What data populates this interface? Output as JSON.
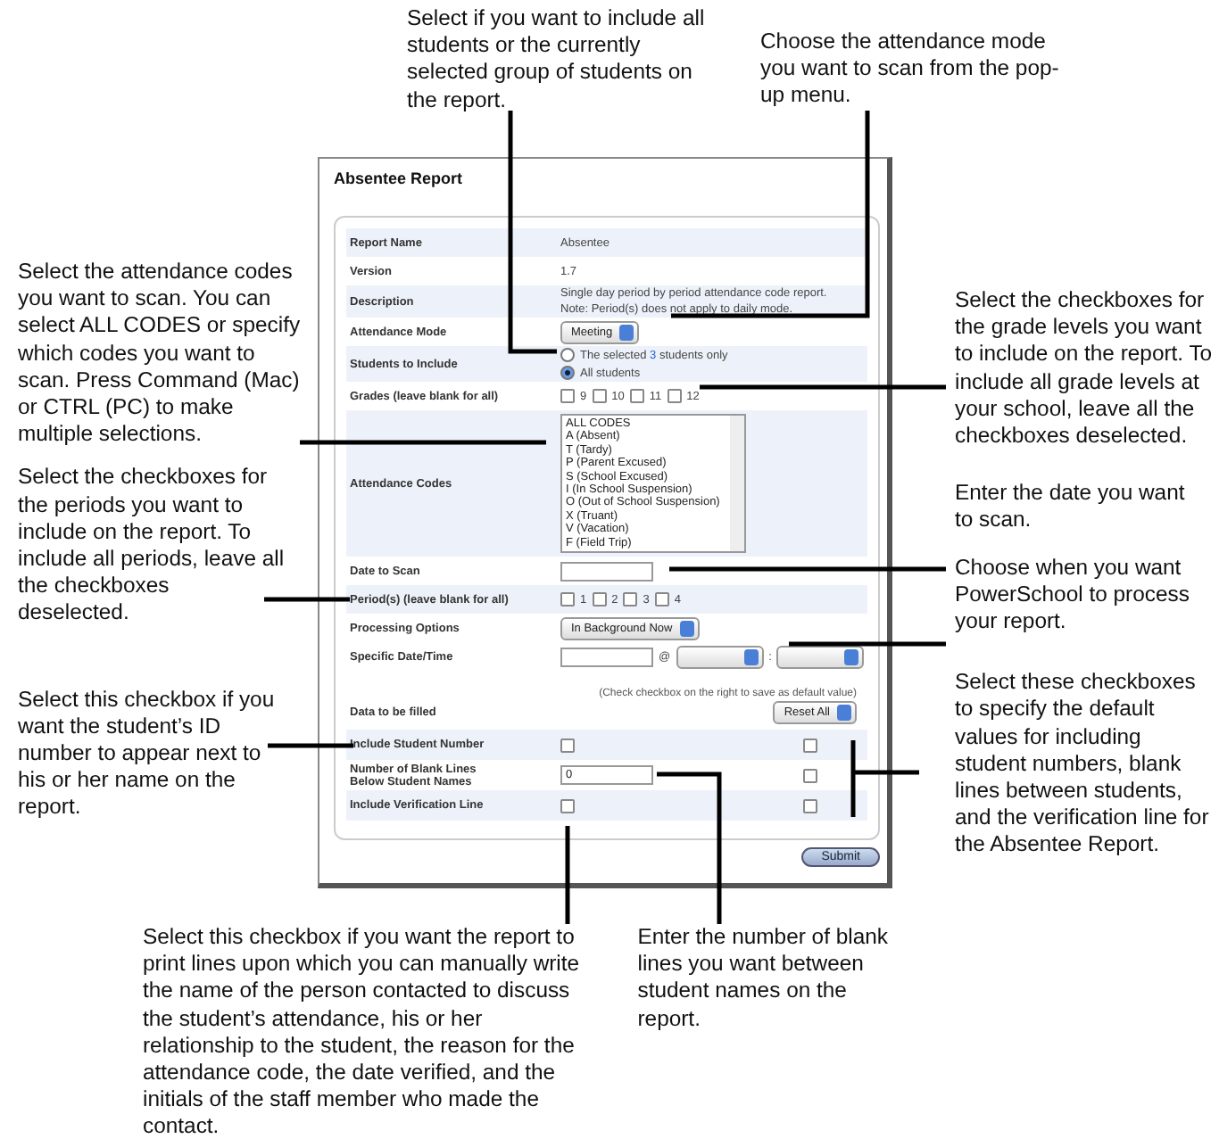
{
  "callouts": {
    "top": [
      "Select if you want to include all students or the currently selected group of students on the report.",
      "Choose the attendance mode you want to scan from the pop-up menu."
    ],
    "left": [
      "Select the attendance codes you want to scan. You can select ALL CODES or specify which codes you want to scan. Press Command (Mac) or CTRL (PC) to make multiple selections.",
      "Select the checkboxes for the periods you want to include on the report. To include all periods, leave all the checkboxes deselected.",
      "Select this checkbox if you want the student’s ID number to appear next to his or her name on the report."
    ],
    "right": [
      "Select the checkboxes for the  grade levels you want to include on the report. To include all grade levels at your school, leave all the checkboxes deselected.",
      "Enter the date you want to scan.",
      "Choose when you want PowerSchool to process your report.",
      "Select these checkboxes to specify the default values for including student numbers, blank lines between students, and the verification line for the Absentee Report."
    ],
    "bottom": [
      "Select this checkbox if you want the report to print lines upon which you can manually write the name of the person contacted to discuss the student’s attendance, his or her relationship to the student, the reason for the attendance code, the date verified, and the initials of the staff member who made the contact.",
      "Enter the number of blank lines you want between student names on the report."
    ]
  },
  "window": {
    "title": "Absentee Report",
    "submit": "Submit"
  },
  "rows": [
    {
      "kind": "info",
      "label": "Report Name",
      "lines": [
        "Absentee"
      ]
    },
    {
      "kind": "info",
      "label": "Version",
      "lines": [
        "1.7"
      ]
    },
    {
      "kind": "info",
      "label": "Description",
      "lines": [
        "Single day period by period attendance code report.",
        "Note: Period(s) does not apply to daily mode."
      ]
    },
    {
      "kind": "select",
      "label": "Attendance Mode",
      "value": "Meeting"
    },
    {
      "kind": "radio",
      "label": "Students to Include",
      "options": [
        {
          "before": "The selected",
          "link": "3",
          "after": "students only",
          "selected": false
        },
        {
          "before": "All students",
          "selected": true
        }
      ]
    },
    {
      "kind": "checkboxes",
      "label": "Grades (leave blank for all)",
      "options": [
        {
          "label": "9",
          "checked": false
        },
        {
          "label": "10",
          "checked": false
        },
        {
          "label": "11",
          "checked": false
        },
        {
          "label": "12",
          "checked": false
        }
      ]
    },
    {
      "kind": "listbox",
      "label": "Attendance Codes",
      "options": [
        "ALL CODES",
        "A (Absent)",
        "T (Tardy)",
        "P (Parent Excused)",
        "S (School Excused)",
        "I (In School Suspension)",
        "O (Out of School Suspension)",
        "X (Truant)",
        "V (Vacation)",
        "F (Field Trip)"
      ]
    },
    {
      "kind": "input",
      "label": "Date to Scan"
    },
    {
      "kind": "checkboxes",
      "label": "Period(s) (leave blank for all)",
      "options": [
        {
          "label": "1",
          "checked": false
        },
        {
          "label": "2",
          "checked": false
        },
        {
          "label": "3",
          "checked": false
        },
        {
          "label": "4",
          "checked": false
        }
      ]
    },
    {
      "kind": "select",
      "label": "Processing Options",
      "value": "In Background Now"
    },
    {
      "kind": "datetime",
      "label": "Specific Date/Time",
      "at": "@",
      "colon": ":"
    },
    {
      "kind": "header",
      "label": "Data to be filled",
      "note": "(Check checkbox on the right to save as default value)",
      "button": "Reset All"
    },
    {
      "kind": "option",
      "label": "Include Student Number",
      "checked": false,
      "default_checked": false
    },
    {
      "kind": "option",
      "label": "Number of Blank Lines Below Student Names",
      "value": "0",
      "default_checked": false
    },
    {
      "kind": "option",
      "label": "Include Verification Line",
      "checked": false,
      "default_checked": false
    }
  ]
}
